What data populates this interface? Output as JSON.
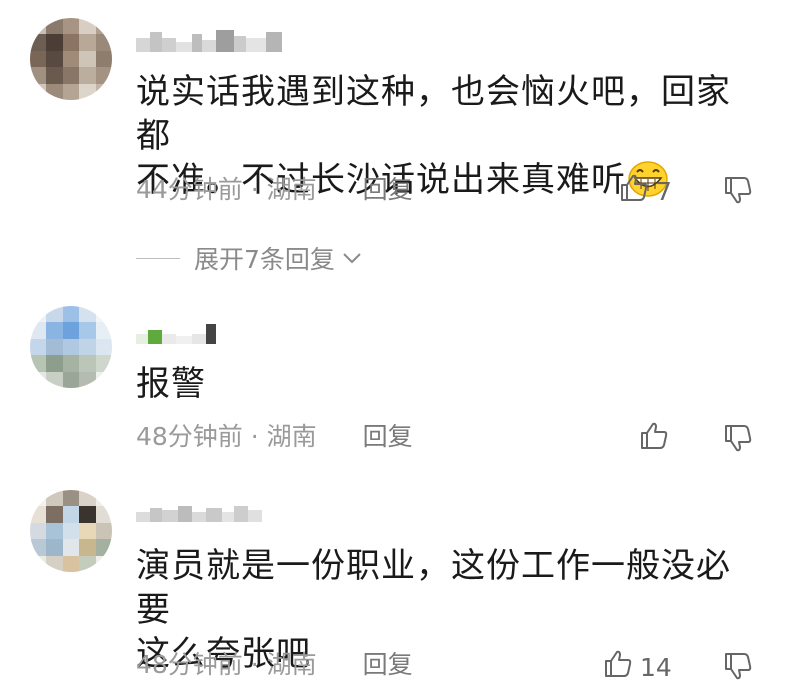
{
  "comments": [
    {
      "text_line1": "说实话我遇到这种，也会恼火吧，回家都",
      "text_line2": "不准。不过长沙话说出来真难听",
      "emoji": "grinning-face",
      "time": "44分钟前",
      "sep": " · ",
      "location": "湖南",
      "reply_label": "回复",
      "like_count": "7",
      "expand_label": "展开7条回复"
    },
    {
      "text_line1": "报警",
      "time": "48分钟前",
      "sep": " · ",
      "location": "湖南",
      "reply_label": "回复",
      "like_count": ""
    },
    {
      "text_line1": "演员就是一份职业，这份工作一般没必要",
      "text_line2": "这么夸张吧",
      "time": "48分钟前",
      "sep": " · ",
      "location": "湖南",
      "reply_label": "回复",
      "like_count": "14"
    }
  ],
  "icons": {
    "like": "thumbs-up-icon",
    "dislike": "thumbs-down-icon",
    "expand": "chevron-down-icon"
  },
  "colors": {
    "text": "#1a1a1a",
    "meta": "#9a9a9a",
    "icon": "#666666"
  }
}
